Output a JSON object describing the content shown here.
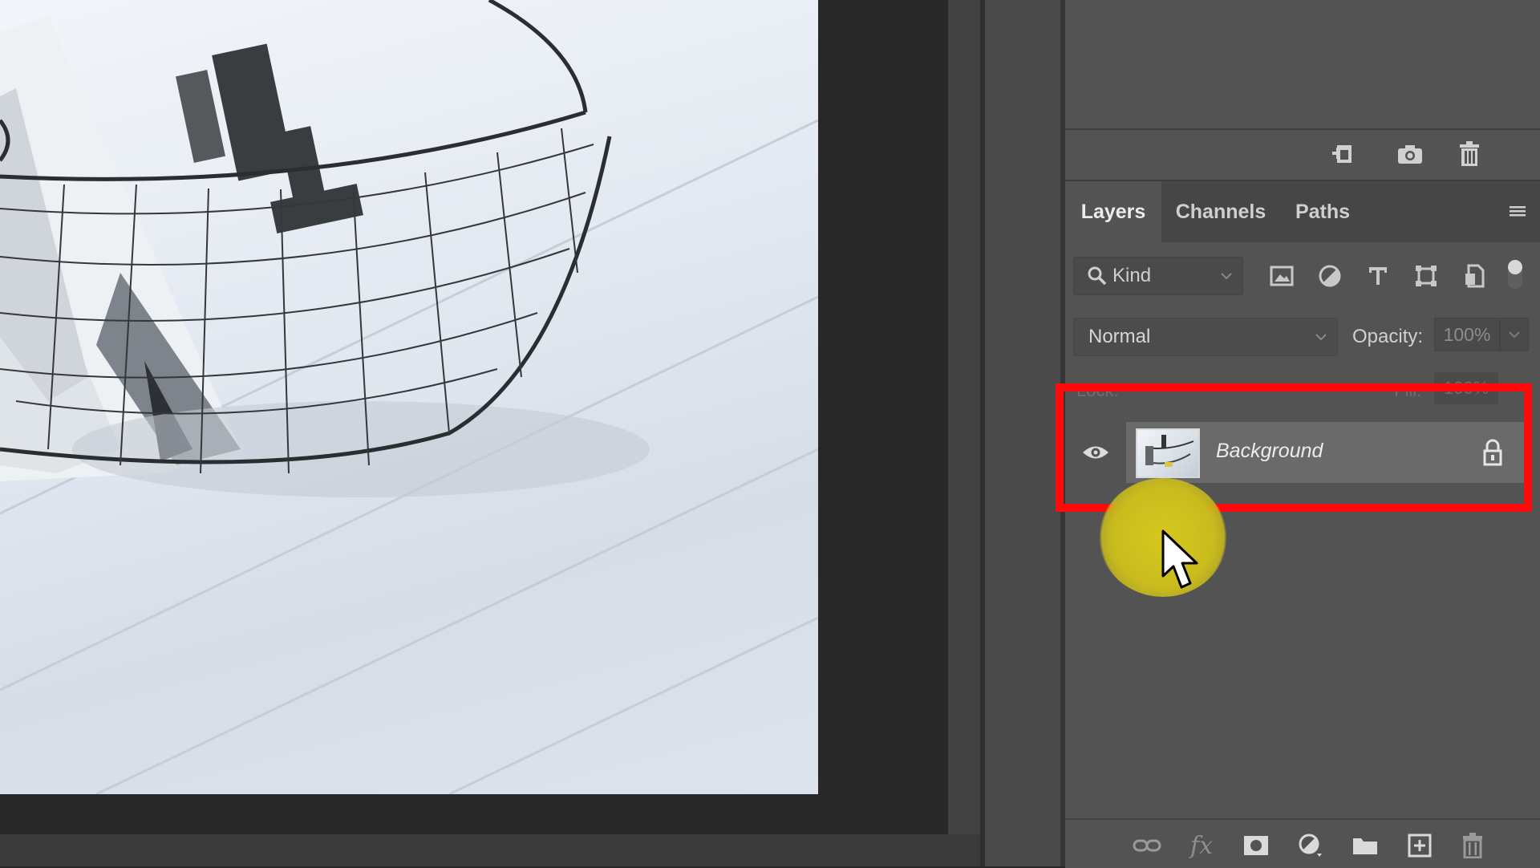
{
  "colors": {
    "app_background": "#282828",
    "panel_background": "#535353",
    "tab_bar_background": "#464646",
    "selected_layer": "#6a6a6a",
    "annotation_box": "#ff0a0a",
    "click_highlight": "#c9bb1d"
  },
  "history_toolbar": {
    "icons": [
      "new-document-from-state-icon",
      "camera-snapshot-icon",
      "trash-icon"
    ]
  },
  "layers_panel": {
    "tabs": [
      {
        "label": "Layers",
        "active": true
      },
      {
        "label": "Channels",
        "active": false
      },
      {
        "label": "Paths",
        "active": false
      }
    ],
    "menu_icon": "hamburger-menu-icon",
    "filter": {
      "label": "Kind",
      "icons": [
        "image-filter-icon",
        "adjustment-filter-icon",
        "type-filter-icon",
        "shape-filter-icon",
        "smart-object-filter-icon"
      ]
    },
    "blend_mode": "Normal",
    "opacity_label": "Opacity:",
    "opacity_value": "100%",
    "lock_label": "Lock:",
    "fill_label": "Fill:",
    "fill_value": "100%",
    "layers": [
      {
        "name": "Background",
        "visible": true,
        "locked": true,
        "selected": true
      }
    ],
    "bottom_icons": [
      "link-layers-icon",
      "fx-icon",
      "add-mask-icon",
      "adjustment-layer-icon",
      "group-folder-icon",
      "new-layer-icon",
      "delete-layer-icon"
    ],
    "fx_text": "fx"
  }
}
